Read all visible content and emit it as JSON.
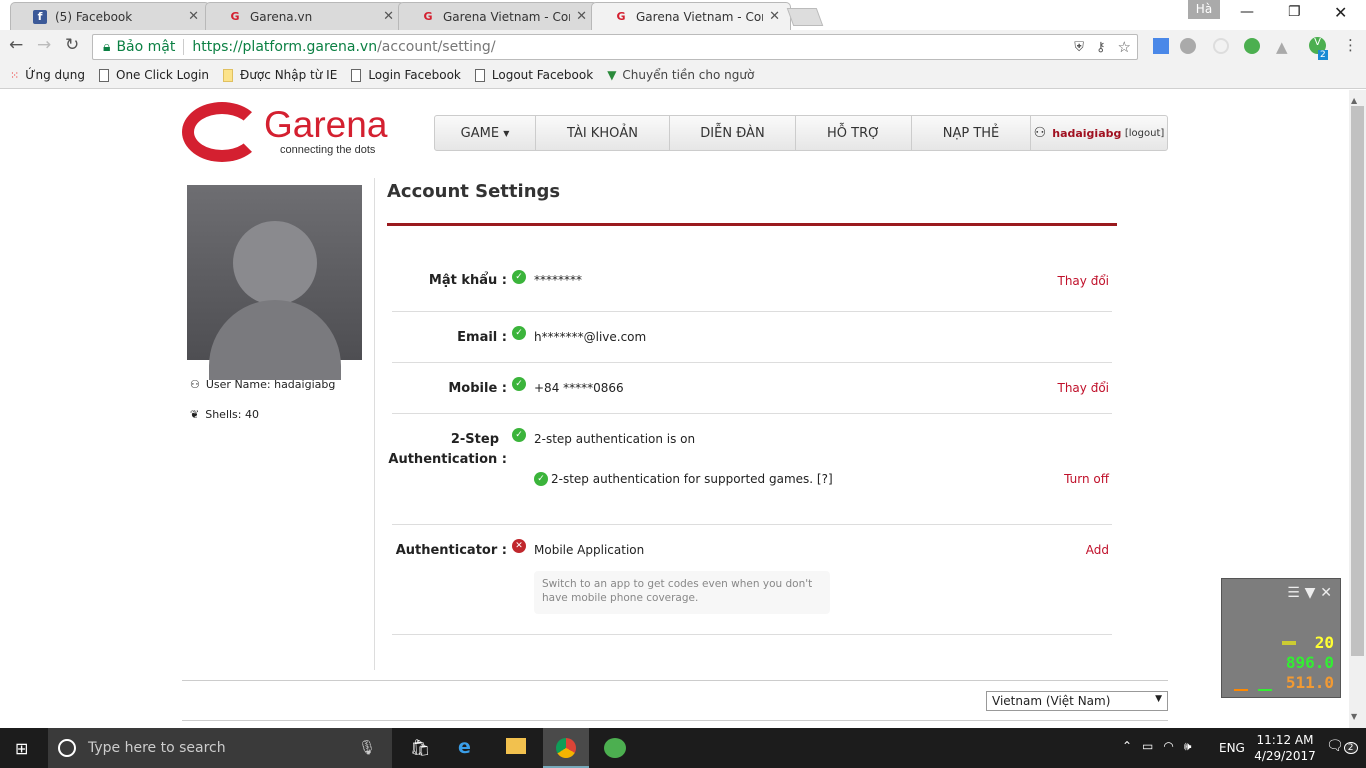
{
  "browser": {
    "tabs": [
      {
        "title": "(5) Facebook"
      },
      {
        "title": "Garena.vn"
      },
      {
        "title": "Garena Vietnam - Conne"
      },
      {
        "title": "Garena Vietnam - Conne"
      }
    ],
    "profile": "Hà",
    "secure_label": "Bảo mật",
    "url_host": "https://platform.garena.vn",
    "url_path": "/account/setting/",
    "bookmarks": [
      "Ứng dụng",
      "One Click Login",
      "Được Nhập từ IE",
      "Login Facebook",
      "Logout Facebook",
      "Chuyển tiền cho ngườ"
    ],
    "ext_badge": "2"
  },
  "site": {
    "logo": "Garena",
    "tagline": "connecting the dots",
    "nav": [
      "GAME",
      "TÀI KHOẢN",
      "DIỄN ĐÀN",
      "HỖ TRỢ",
      "NẠP THẺ"
    ],
    "username": "hadaigiabg",
    "logout": "[logout]"
  },
  "sidebar": {
    "user_name": "User Name: hadaigiabg",
    "shells": "Shells: 40"
  },
  "main": {
    "title": "Account Settings",
    "password": {
      "label": "Mật khẩu :",
      "value": "********",
      "action": "Thay đổi"
    },
    "email": {
      "label": "Email :",
      "value": "h*******@live.com"
    },
    "mobile": {
      "label": "Mobile :",
      "value": "+84 *****0866",
      "action": "Thay đổi"
    },
    "twostep": {
      "label1": "2-Step",
      "label2": "Authentication :",
      "status": "2-step authentication is on",
      "games": "2-step authentication for supported games. [?]",
      "action": "Turn off"
    },
    "authenticator": {
      "label": "Authenticator :",
      "value": "Mobile Application",
      "action": "Add",
      "hint": "Switch to an app to get codes even when you don't have mobile phone coverage."
    }
  },
  "footer": {
    "language": "Vietnam (Việt Nam)"
  },
  "widget": {
    "v1": "20",
    "v2": "896.0",
    "v3": "511.0"
  },
  "taskbar": {
    "search": "Type here to search",
    "lang": "ENG",
    "time": "11:12 AM",
    "date": "4/29/2017",
    "notif": "2"
  }
}
